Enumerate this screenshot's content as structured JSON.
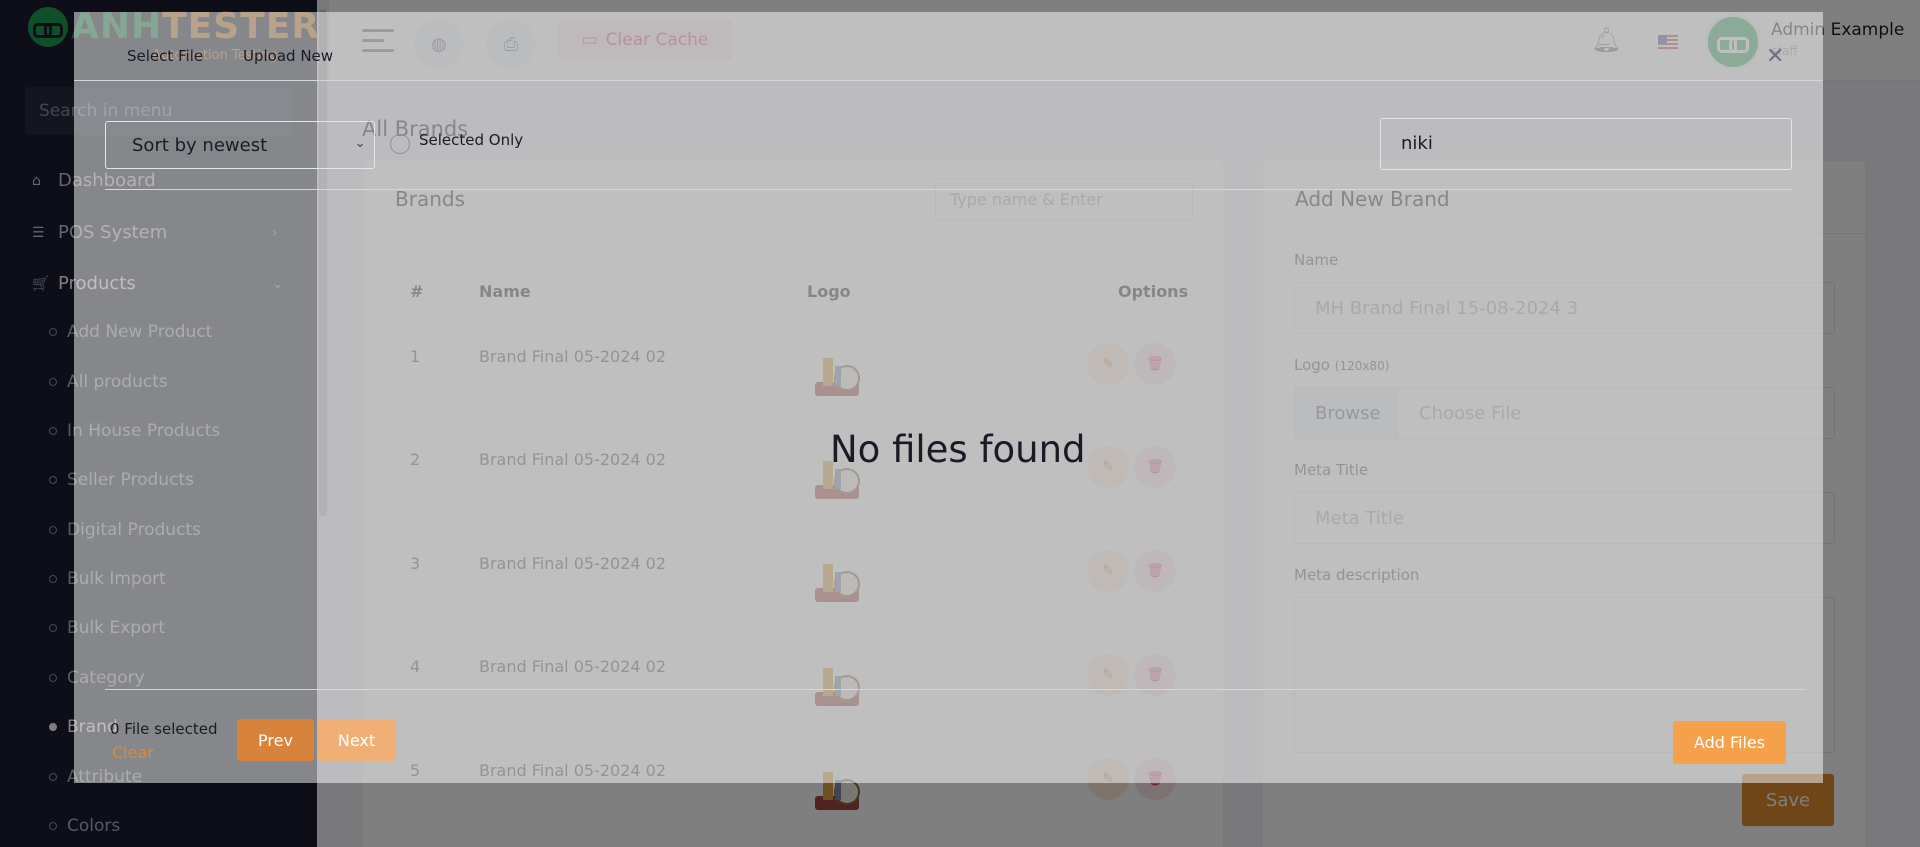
{
  "brand": {
    "logo_text": "ANHTESTER",
    "logo_sub": "Automation Testing"
  },
  "sidebar": {
    "search_placeholder": "Search in menu",
    "items": [
      {
        "label": "Dashboard",
        "icon": "home-icon"
      },
      {
        "label": "POS System",
        "icon": "list-icon"
      },
      {
        "label": "Products",
        "icon": "cart-icon"
      }
    ],
    "sub_items": [
      "Add New Product",
      "All products",
      "In House Products",
      "Seller Products",
      "Digital Products",
      "Bulk Import",
      "Bulk Export",
      "Category",
      "Brand",
      "Attribute",
      "Colors"
    ]
  },
  "topbar": {
    "clear_cache": "Clear Cache",
    "user_name": "Admin Example",
    "user_role": "staff"
  },
  "page": {
    "title": "All Brands"
  },
  "brands_card": {
    "title": "Brands",
    "search_placeholder": "Type name & Enter",
    "columns": [
      "#",
      "Name",
      "Logo",
      "Options"
    ],
    "rows": [
      {
        "num": "1",
        "name": "Brand Final 05-2024 02"
      },
      {
        "num": "2",
        "name": "Brand Final 05-2024 02"
      },
      {
        "num": "3",
        "name": "Brand Final 05-2024 02"
      },
      {
        "num": "4",
        "name": "Brand Final 05-2024 02"
      },
      {
        "num": "5",
        "name": "Brand Final 05-2024 02"
      }
    ]
  },
  "add_brand": {
    "title": "Add New Brand",
    "name_label": "Name",
    "name_value": "MH Brand Final 15-08-2024 3",
    "logo_label": "Logo",
    "logo_hint": "(120x80)",
    "browse_label": "Browse",
    "choose_file": "Choose File",
    "meta_title_label": "Meta Title",
    "meta_title_placeholder": "Meta Title",
    "meta_desc_label": "Meta description",
    "save_label": "Save"
  },
  "modal": {
    "tab_select": "Select File",
    "tab_upload": "Upload New",
    "sort_value": "Sort by newest",
    "selected_only": "Selected Only",
    "search_value": "niki",
    "empty_text": "No files found",
    "files_selected": "0 File selected",
    "clear_label": "Clear",
    "prev_label": "Prev",
    "next_label": "Next",
    "add_files_label": "Add Files"
  },
  "colors": {
    "accent": "#e08a2e",
    "danger": "#e6476b",
    "sidebar_bg": "#1b1d2e",
    "success": "#1f9e55"
  }
}
